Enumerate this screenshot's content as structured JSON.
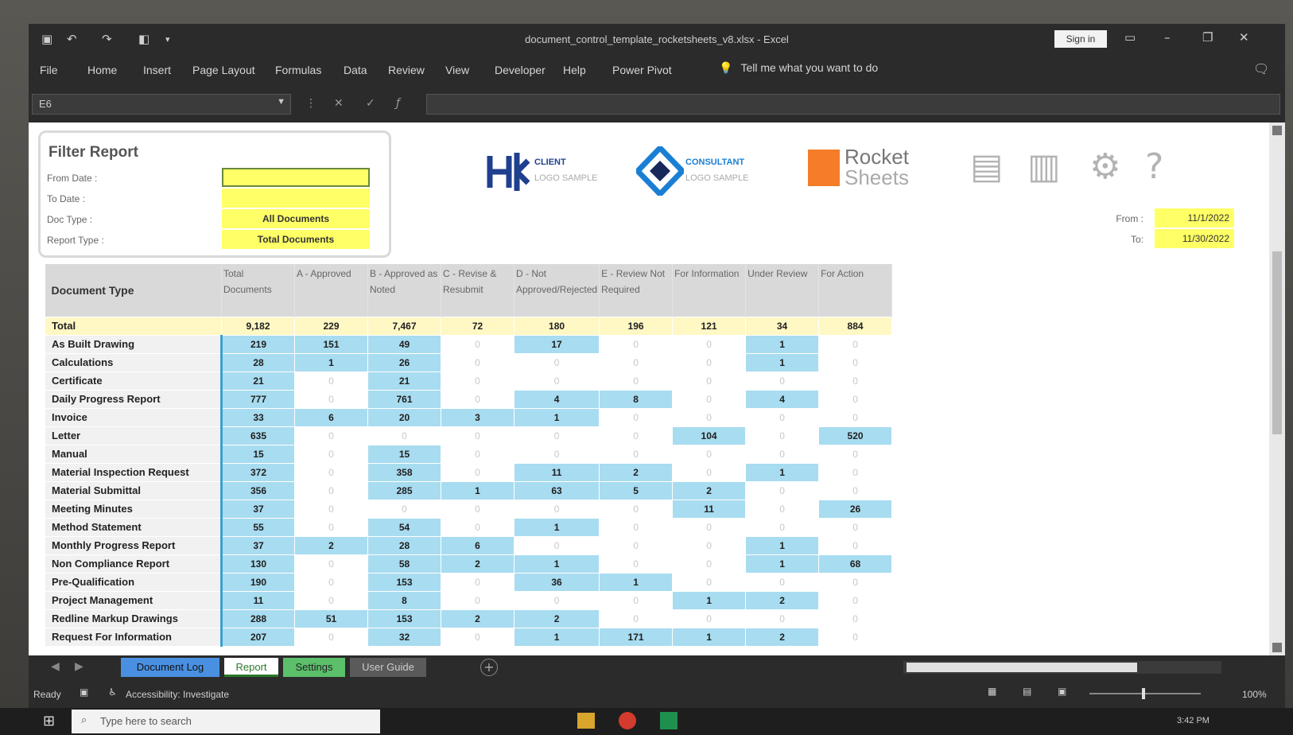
{
  "title_bar": {
    "doc_title": "document_control_template_rocketsheets_v8.xlsx - Excel",
    "sign_in": "Sign in"
  },
  "ribbon_tabs": [
    "File",
    "Home",
    "Insert",
    "Page Layout",
    "Formulas",
    "Data",
    "Review",
    "View",
    "Developer",
    "Help",
    "Power Pivot"
  ],
  "tell_me": "Tell me what you want to do",
  "name_box": "E6",
  "filter": {
    "title": "Filter Report",
    "labels": [
      "From Date :",
      "To Date :",
      "Doc Type :",
      "Report Type :"
    ],
    "doc_type_value": "All Documents",
    "report_type_value": "Total Documents"
  },
  "logos": {
    "client_line1": "CLIENT",
    "client_line2": "LOGO SAMPLE",
    "consultant_line1": "CONSULTANT",
    "consultant_line2": "LOGO SAMPLE",
    "rocket_line1": "Rocket",
    "rocket_line2": "Sheets"
  },
  "date_range": {
    "from_label": "From :",
    "from_value": "11/1/2022",
    "to_label": "To:",
    "to_value": "11/30/2022"
  },
  "table": {
    "headers": [
      "Document Type",
      "Total Documents",
      "A - Approved",
      "B - Approved as Noted",
      "C - Revise & Resubmit",
      "D - Not Approved/Rejected",
      "E - Review Not Required",
      "For Information",
      "Under Review",
      "For Action"
    ],
    "total_label": "Total",
    "total_values": [
      "9,182",
      "229",
      "7,467",
      "72",
      "180",
      "196",
      "121",
      "34",
      "884"
    ],
    "rows": [
      {
        "name": "As Built Drawing",
        "values": [
          "219",
          "151",
          "49",
          "0",
          "17",
          "0",
          "0",
          "1",
          "0"
        ]
      },
      {
        "name": "Calculations",
        "values": [
          "28",
          "1",
          "26",
          "0",
          "0",
          "0",
          "0",
          "1",
          "0"
        ]
      },
      {
        "name": "Certificate",
        "values": [
          "21",
          "0",
          "21",
          "0",
          "0",
          "0",
          "0",
          "0",
          "0"
        ]
      },
      {
        "name": "Daily Progress Report",
        "values": [
          "777",
          "0",
          "761",
          "0",
          "4",
          "8",
          "0",
          "4",
          "0"
        ]
      },
      {
        "name": "Invoice",
        "values": [
          "33",
          "6",
          "20",
          "3",
          "1",
          "0",
          "0",
          "0",
          "0"
        ]
      },
      {
        "name": "Letter",
        "values": [
          "635",
          "0",
          "0",
          "0",
          "0",
          "0",
          "104",
          "0",
          "520"
        ]
      },
      {
        "name": "Manual",
        "values": [
          "15",
          "0",
          "15",
          "0",
          "0",
          "0",
          "0",
          "0",
          "0"
        ]
      },
      {
        "name": "Material Inspection Request",
        "values": [
          "372",
          "0",
          "358",
          "0",
          "11",
          "2",
          "0",
          "1",
          "0"
        ]
      },
      {
        "name": "Material Submittal",
        "values": [
          "356",
          "0",
          "285",
          "1",
          "63",
          "5",
          "2",
          "0",
          "0"
        ]
      },
      {
        "name": "Meeting Minutes",
        "values": [
          "37",
          "0",
          "0",
          "0",
          "0",
          "0",
          "11",
          "0",
          "26"
        ]
      },
      {
        "name": "Method Statement",
        "values": [
          "55",
          "0",
          "54",
          "0",
          "1",
          "0",
          "0",
          "0",
          "0"
        ]
      },
      {
        "name": "Monthly Progress Report",
        "values": [
          "37",
          "2",
          "28",
          "6",
          "0",
          "0",
          "0",
          "1",
          "0"
        ]
      },
      {
        "name": "Non Compliance Report",
        "values": [
          "130",
          "0",
          "58",
          "2",
          "1",
          "0",
          "0",
          "1",
          "68"
        ]
      },
      {
        "name": "Pre-Qualification",
        "values": [
          "190",
          "0",
          "153",
          "0",
          "36",
          "1",
          "0",
          "0",
          "0"
        ]
      },
      {
        "name": "Project Management",
        "values": [
          "11",
          "0",
          "8",
          "0",
          "0",
          "0",
          "1",
          "2",
          "0"
        ]
      },
      {
        "name": "Redline Markup Drawings",
        "values": [
          "288",
          "51",
          "153",
          "2",
          "2",
          "0",
          "0",
          "0",
          "0"
        ]
      },
      {
        "name": "Request For Information",
        "values": [
          "207",
          "0",
          "32",
          "0",
          "1",
          "171",
          "1",
          "2",
          "0"
        ]
      }
    ]
  },
  "sheet_tabs": [
    "Document Log",
    "Report",
    "Settings",
    "User Guide"
  ],
  "status": {
    "ready": "Ready",
    "accessibility": "Accessibility: Investigate",
    "zoom": "100%",
    "time": "3:42 PM"
  },
  "taskbar": {
    "search_placeholder": "Type here to search"
  },
  "colors": {
    "highlight_cell": "#a8dcf0",
    "input_yellow": "#ffff66",
    "total_row": "#fff8c4",
    "sheet_tab_document_log": "#4a90e2",
    "sheet_tab_settings": "#5cbf6a"
  }
}
